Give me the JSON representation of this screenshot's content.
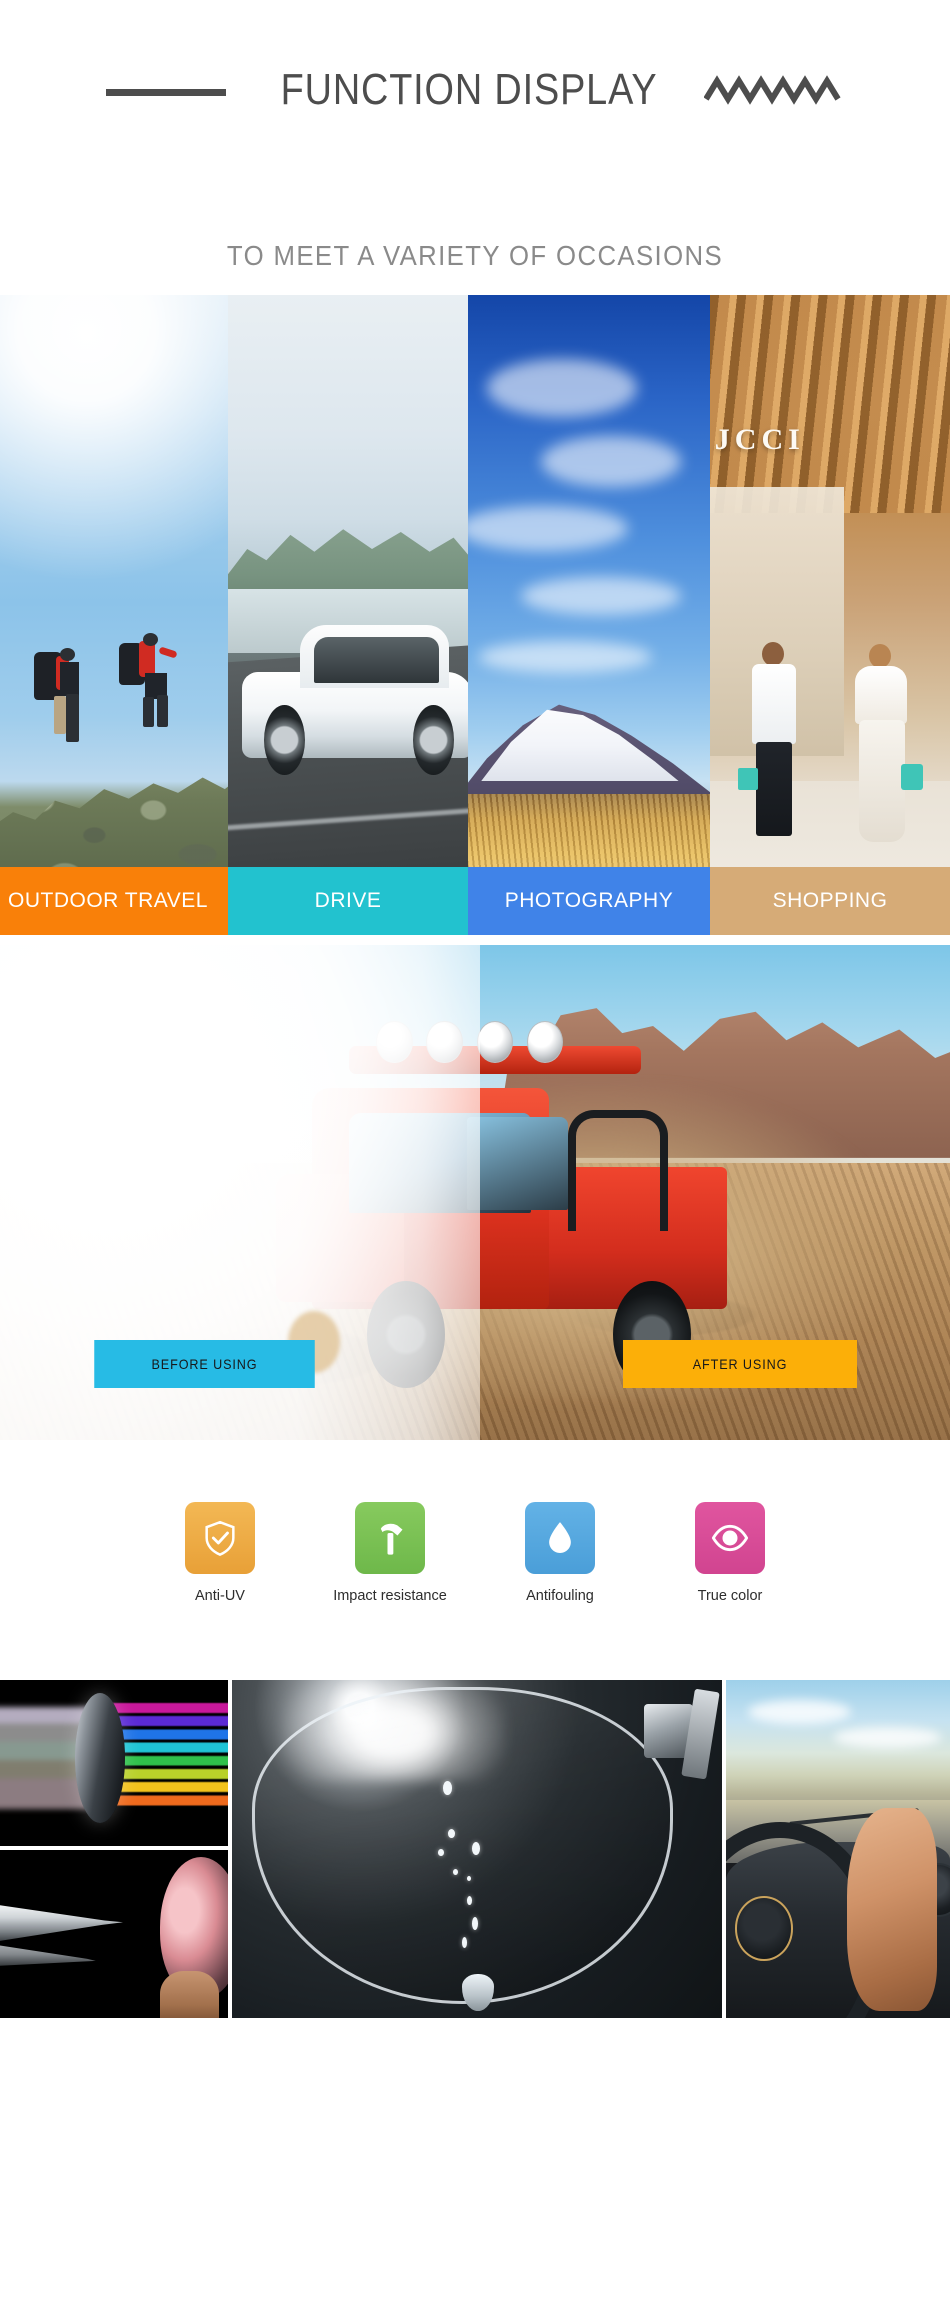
{
  "header": {
    "title": "FUNCTION DISPLAY",
    "rule_icon": "horizontal-rule",
    "zigzag_icon": "zigzag-decoration",
    "accent_color": "#4d4d4d"
  },
  "subtitle": {
    "text": "TO MEET A VARIETY OF OCCASIONS",
    "color": "#8a8a8a"
  },
  "occasions": {
    "items": [
      {
        "label": "OUTDOOR TRAVEL",
        "color": "#f98009",
        "scene": "hikers-on-mountain-ridge"
      },
      {
        "label": "DRIVE",
        "color": "#22c2cf",
        "scene": "white-car-on-lakeside-road"
      },
      {
        "label": "PHOTOGRAPHY",
        "color": "#4083e8",
        "scene": "snow-mountain-over-wheat-field"
      },
      {
        "label": "SHOPPING",
        "color": "#d6ab77",
        "scene": "couple-walking-past-gucci-store"
      }
    ]
  },
  "before_after": {
    "scene": "red-pickup-truck-in-desert-dust",
    "before": {
      "label": "BEFORE USING",
      "color": "#27bbe5",
      "text_color": "#17181a"
    },
    "after": {
      "label": "AFTER USING",
      "color": "#fcaf08",
      "text_color": "#17181a"
    }
  },
  "features": {
    "items": [
      {
        "label": "Anti-UV",
        "icon": "shield-check-icon",
        "color": "#f0ae47"
      },
      {
        "label": "Impact resistance",
        "icon": "hammer-icon",
        "color": "#7cc254"
      },
      {
        "label": "Antifouling",
        "icon": "water-drop-icon",
        "color": "#59a9e0"
      },
      {
        "label": "True color",
        "icon": "eye-icon",
        "color": "#e0509c"
      }
    ]
  },
  "gallery": {
    "items": [
      {
        "name": "lens-prism-spectrum",
        "caption": ""
      },
      {
        "name": "needle-impact-on-lens",
        "caption": ""
      },
      {
        "name": "water-drop-on-lens",
        "caption": ""
      },
      {
        "name": "driver-point-of-view",
        "caption": ""
      }
    ]
  }
}
